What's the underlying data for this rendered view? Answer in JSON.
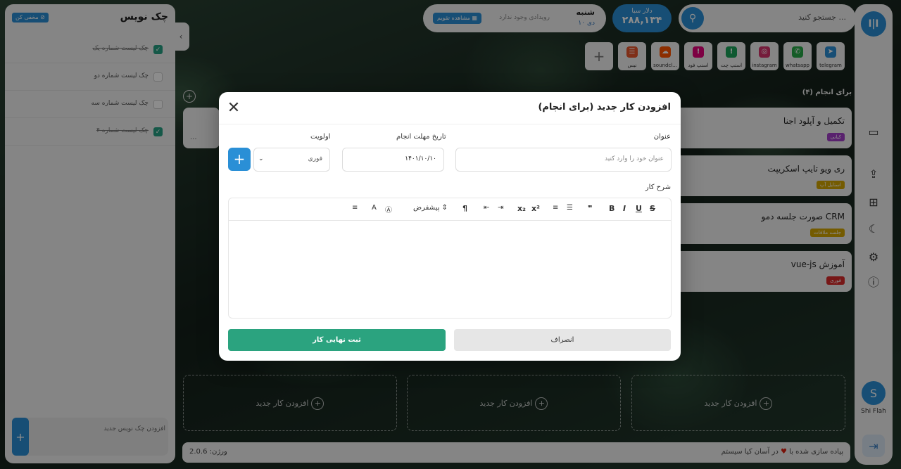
{
  "rail": {
    "logo": "ا|ا",
    "user_initial": "S",
    "user_name": "Shi Flah"
  },
  "search": {
    "placeholder": "جستجو کنید ..."
  },
  "dollar": {
    "label": "دلار سبا",
    "value": "۲۸۸,۱۳۴"
  },
  "date": {
    "day": "شنبه",
    "date": "۱۰ دی",
    "no_event": "رویدادی وجود ندارد",
    "calendar_button": "مشاهده تقویم"
  },
  "apps": [
    {
      "label": "telegram",
      "icon": "telegram-icon",
      "color": "#2a8fd6",
      "glyph": "➤"
    },
    {
      "label": "whatsapp",
      "icon": "whatsapp-icon",
      "color": "#27a847",
      "glyph": "✆"
    },
    {
      "label": "instagram",
      "icon": "instagram-icon",
      "color": "#d6336c",
      "glyph": "◎"
    },
    {
      "label": "اسنپ چت",
      "icon": "snapp-icon",
      "color": "#1aa35a",
      "glyph": "!"
    },
    {
      "label": "اسنپ فود",
      "icon": "snappfood-icon",
      "color": "#e3007a",
      "glyph": "!"
    },
    {
      "label": "soundcl...",
      "icon": "soundcloud-icon",
      "color": "#ff5500",
      "glyph": "☁"
    },
    {
      "label": "نیس",
      "icon": "app-icon",
      "color": "#e8572d",
      "glyph": "☰"
    }
  ],
  "checklist": {
    "title": "چک نویس",
    "select_label": "مخفی کن",
    "items": [
      {
        "text": "چک لیست شماره یک",
        "done": true
      },
      {
        "text": "چک لیست شماره دو",
        "done": false
      },
      {
        "text": "چک لیست شماره سه",
        "done": false
      },
      {
        "text": "چک لیست شماره ۴",
        "done": true
      }
    ],
    "new_placeholder": "افزودن چک نویس جدید"
  },
  "board": {
    "column_title": "برای انجام (۴)",
    "left_card_more": "...",
    "cards": [
      {
        "title": "تکمیل و آپلود اجنا",
        "tag": "کیانی",
        "tag_color": "#a23ec9"
      },
      {
        "title": "ری ویو تایپ اسکریپت",
        "tag": "استایل آپ",
        "tag_color": "#d3a600"
      },
      {
        "title": "صورت جلسه دمو CRM",
        "tag": "جلسه ملاقات",
        "tag_color": "#d3a600"
      },
      {
        "title": "vue-js آموزش",
        "tag": "فوری",
        "tag_color": "#d92b2b"
      }
    ],
    "add_task": "افزودن کار جدید"
  },
  "footer": {
    "credit_pre": "پیاده سازی شده با",
    "credit_post": "در آسان کیا سیستم",
    "version": "ورژن: 2.0.6"
  },
  "modal": {
    "title": "افزودن کار جدید (برای انجام)",
    "title_label": "عنوان",
    "title_placeholder": "عنوان خود را وارد کنید",
    "due_label": "تاریخ مهلت انجام",
    "due_value": "۱۴۰۱/۱۰/۱۰",
    "priority_label": "اولویت",
    "priority_value": "فوری",
    "desc_label": "شرح کار",
    "format_label": "پیشفرض",
    "cancel": "انصراف",
    "submit": "ثبت نهایی کار"
  }
}
